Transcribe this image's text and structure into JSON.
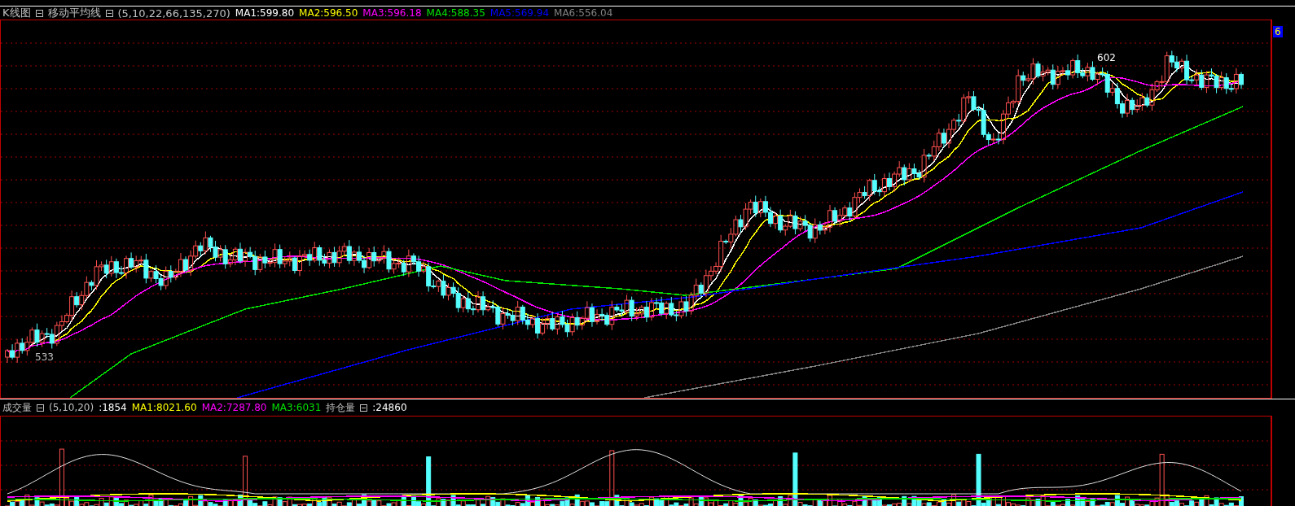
{
  "main_panel": {
    "title": "K线图",
    "indicator": "移动平均线",
    "params": "(5,10,22,66,135,270)",
    "ma": [
      {
        "label": "MA1:599.80",
        "color": "#ffffff"
      },
      {
        "label": "MA2:596.50",
        "color": "#ffff00"
      },
      {
        "label": "MA3:596.18",
        "color": "#ff00ff"
      },
      {
        "label": "MA4:588.35",
        "color": "#00e000"
      },
      {
        "label": "MA5:569.94",
        "color": "#0000ff"
      },
      {
        "label": "MA6:556.04",
        "color": "#808080"
      }
    ],
    "annotations": [
      "602",
      "533"
    ],
    "price_tag": "6"
  },
  "volume_panel": {
    "title": "成交量",
    "params": "(5,10,20)",
    "value": ":1854",
    "ma": [
      {
        "label": "MA1:8021.60",
        "color": "#ffff00"
      },
      {
        "label": "MA2:7287.80",
        "color": "#ff00ff"
      },
      {
        "label": "MA3:6031",
        "color": "#00e000"
      }
    ],
    "open_interest_label": "持仓量",
    "open_interest_value": ":24860"
  }
}
